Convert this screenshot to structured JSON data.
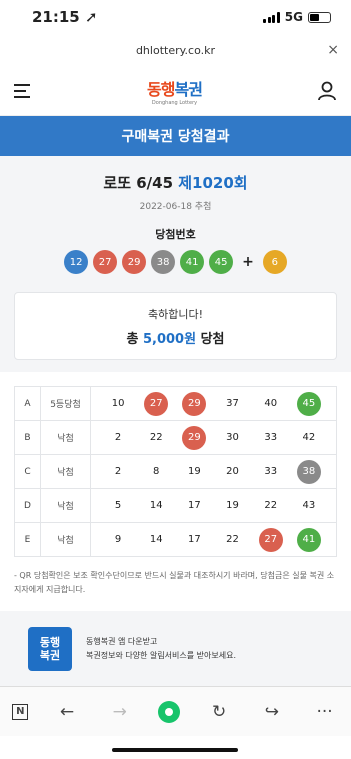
{
  "status": {
    "time": "21:15 ➚",
    "network": "5G"
  },
  "url": {
    "host": "dhlottery.co.kr",
    "close": "×"
  },
  "logo": {
    "main_a": "동행",
    "main_b": "복권",
    "sub": "Donghang Lottery"
  },
  "banner": {
    "title": "구매복권 당첨결과"
  },
  "game": {
    "name": "로또 6/45",
    "round": "제1020회",
    "date": "2022-06-18 추첨"
  },
  "winning": {
    "label": "당첨번호",
    "numbers": [
      12,
      27,
      29,
      38,
      41,
      45
    ],
    "bonus": 6,
    "plus": "+"
  },
  "result": {
    "congrats": "축하합니다!",
    "prefix": "총",
    "amount": "5,000원",
    "suffix": "당첨"
  },
  "tickets": [
    {
      "label": "A",
      "rank": "5등당첨",
      "numbers": [
        10,
        27,
        29,
        37,
        40,
        45
      ]
    },
    {
      "label": "B",
      "rank": "낙첨",
      "numbers": [
        2,
        22,
        29,
        30,
        33,
        42
      ]
    },
    {
      "label": "C",
      "rank": "낙첨",
      "numbers": [
        2,
        8,
        19,
        20,
        33,
        38
      ]
    },
    {
      "label": "D",
      "rank": "낙첨",
      "numbers": [
        5,
        14,
        17,
        19,
        22,
        43
      ]
    },
    {
      "label": "E",
      "rank": "낙첨",
      "numbers": [
        9,
        14,
        17,
        22,
        27,
        41
      ]
    }
  ],
  "note": "- QR 당첨확인은 보조 확인수단이므로 반드시 실물과 대조하시기 바라며, 당첨금은 실물 복권 소지자에게 지급합니다.",
  "promo": {
    "icon_text_a": "동행",
    "icon_text_b": "복권",
    "line1": "동행복권 앱 다운받고",
    "line2": "복권정보와 다양한 알림서비스를 받아보세요."
  },
  "toolbar": {
    "n": "N",
    "back": "←",
    "forward": "→",
    "reload": "↻",
    "share": "↪",
    "more": "···"
  },
  "colors": {
    "yellow": "#e6a826",
    "blue": "#3a80c9",
    "red": "#d9604f",
    "gray": "#8a8a8a",
    "green": "#4fae48"
  }
}
